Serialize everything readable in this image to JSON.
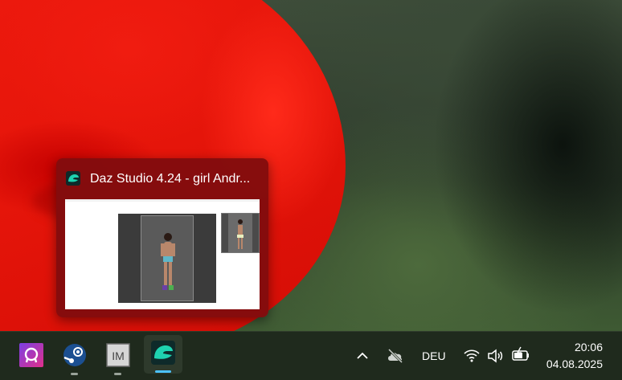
{
  "wallpaper": {
    "subject": "red parrot on green background",
    "colors": {
      "red": "#ee1a0e",
      "green": "#3e4d3a"
    }
  },
  "taskbar_preview": {
    "title": "Daz Studio 4.24 - girl Andr...",
    "app_icon": "daz-studio-icon",
    "background": "#820c0e"
  },
  "taskbar": {
    "apps": [
      {
        "name": "Affinity Photo",
        "icon": "affinity-photo-icon",
        "running": false
      },
      {
        "name": "Steam",
        "icon": "steam-icon",
        "running": true
      },
      {
        "name": "ImageMagick",
        "icon": "imagemagick-icon",
        "label": "IM",
        "running": true
      },
      {
        "name": "Daz Studio",
        "icon": "daz-studio-icon",
        "running": true,
        "active": true
      }
    ],
    "tray": {
      "language": "DEU",
      "icons": [
        "chevron-up-icon",
        "cloud-offline-icon",
        "wifi-icon",
        "volume-icon",
        "battery-charging-icon"
      ]
    },
    "clock": {
      "time": "20:06",
      "date": "04.08.2025"
    },
    "accent": "#4cc2ff"
  }
}
